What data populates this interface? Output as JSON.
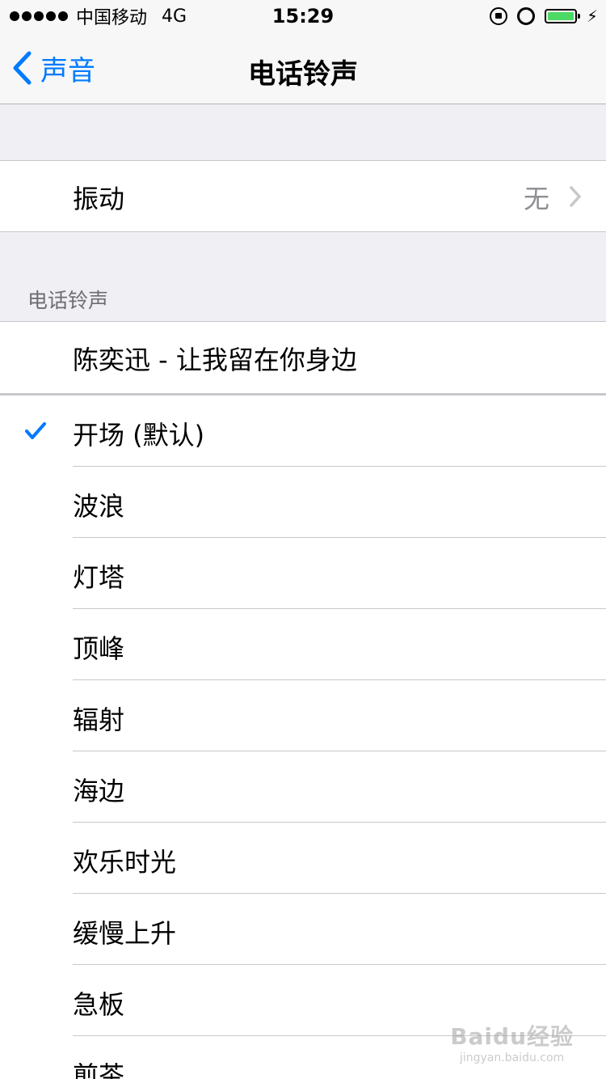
{
  "status_bar": {
    "carrier": "中国移动",
    "network": "4G",
    "time": "15:29",
    "battery_color": "#4cd964"
  },
  "nav": {
    "back_label": "声音",
    "title": "电话铃声",
    "accent_color": "#007aff"
  },
  "vibration": {
    "label": "振动",
    "value": "无"
  },
  "section": {
    "header": "电话铃声"
  },
  "custom_ringtone": "陈奕迅 - 让我留在你身边",
  "ringtones": [
    {
      "label": "开场 (默认)",
      "selected": true
    },
    {
      "label": "波浪",
      "selected": false
    },
    {
      "label": "灯塔",
      "selected": false
    },
    {
      "label": "顶峰",
      "selected": false
    },
    {
      "label": "辐射",
      "selected": false
    },
    {
      "label": "海边",
      "selected": false
    },
    {
      "label": "欢乐时光",
      "selected": false
    },
    {
      "label": "缓慢上升",
      "selected": false
    },
    {
      "label": "急板",
      "selected": false
    },
    {
      "label": "煎茶",
      "selected": false
    }
  ],
  "watermark": {
    "main": "Baidu经验",
    "sub": "jingyan.baidu.com"
  }
}
